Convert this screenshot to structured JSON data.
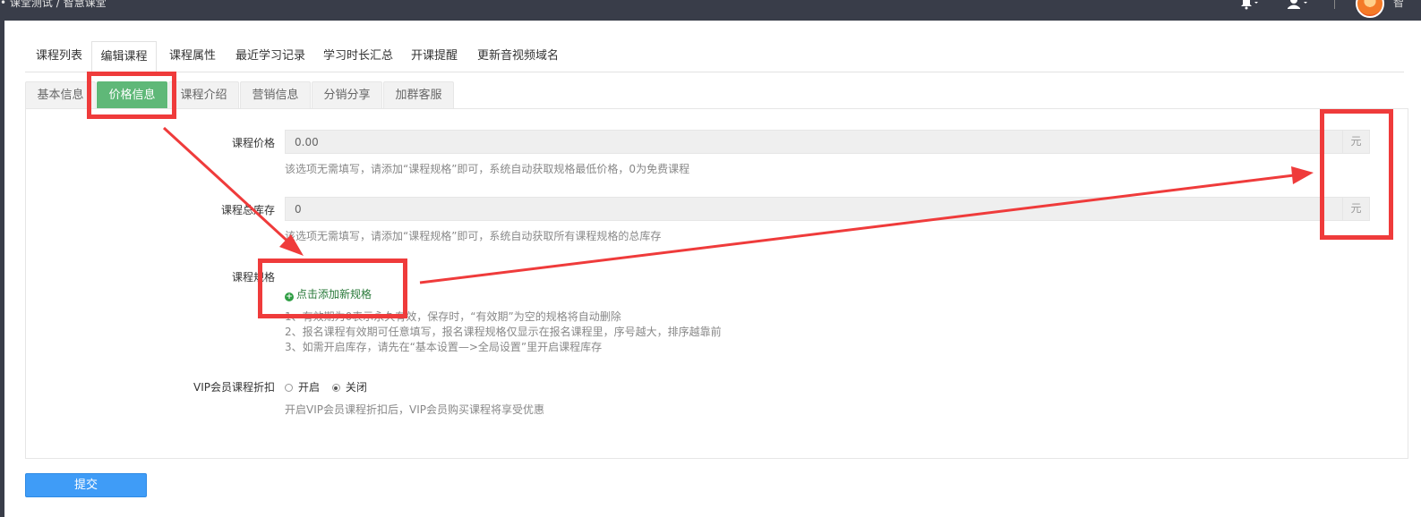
{
  "header": {
    "breadcrumb": "• 课堂测试 / 智慧课堂",
    "user_name": "智"
  },
  "main_tabs": [
    {
      "label": "课程列表",
      "active": false
    },
    {
      "label": "编辑课程",
      "active": true
    },
    {
      "label": "课程属性",
      "active": false
    },
    {
      "label": "最近学习记录",
      "active": false
    },
    {
      "label": "学习时长汇总",
      "active": false
    },
    {
      "label": "开课提醒",
      "active": false
    },
    {
      "label": "更新音视频域名",
      "active": false
    }
  ],
  "sub_tabs": [
    {
      "label": "基本信息",
      "active": false
    },
    {
      "label": "价格信息",
      "active": true
    },
    {
      "label": "课程介绍",
      "active": false
    },
    {
      "label": "营销信息",
      "active": false
    },
    {
      "label": "分销分享",
      "active": false
    },
    {
      "label": "加群客服",
      "active": false
    }
  ],
  "form": {
    "price": {
      "label": "课程价格",
      "value": "0.00",
      "unit": "元",
      "hint": "该选项无需填写，请添加“课程规格”即可，系统自动获取规格最低价格，0为免费课程"
    },
    "stock": {
      "label": "课程总库存",
      "value": "0",
      "unit": "元",
      "hint": "该选项无需填写，请添加“课程规格”即可，系统自动获取所有课程规格的总库存"
    },
    "spec": {
      "label": "课程规格",
      "add_link": "点击添加新规格",
      "notes": [
        "1、有效期为0表示永久有效，保存时，“有效期”为空的规格将自动删除",
        "2、报名课程有效期可任意填写，报名课程规格仅显示在报名课程里，序号越大，排序越靠前",
        "3、如需开启库存，请先在“基本设置—>全局设置”里开启课程库存"
      ]
    },
    "vip": {
      "label": "VIP会员课程折扣",
      "options": [
        {
          "label": "开启",
          "checked": false
        },
        {
          "label": "关闭",
          "checked": true
        }
      ],
      "hint": "开启VIP会员课程折扣后，VIP会员购买课程将享受优惠"
    }
  },
  "submit_label": "提交",
  "colors": {
    "header_bg": "#393d49",
    "active_subtab": "#5fb878",
    "submit_btn": "#3f9cf7",
    "annotation_red": "#ef3b3b"
  }
}
